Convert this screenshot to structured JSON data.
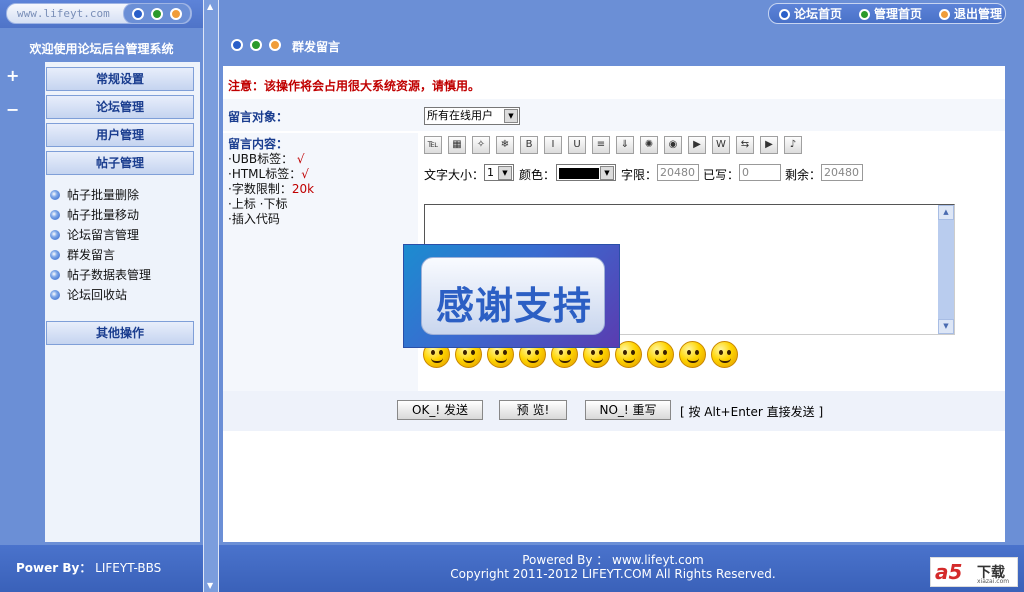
{
  "sidebar": {
    "site_url": "www.lifeyt.com",
    "welcome": "欢迎使用论坛后台管理系统",
    "plus": "+",
    "minus": "−",
    "menu": [
      {
        "label": "常规设置"
      },
      {
        "label": "论坛管理"
      },
      {
        "label": "用户管理"
      },
      {
        "label": "帖子管理"
      },
      {
        "label": "其他操作"
      }
    ],
    "sub_items": [
      {
        "label": "帖子批量删除"
      },
      {
        "label": "帖子批量移动"
      },
      {
        "label": "论坛留言管理"
      },
      {
        "label": "群发留言"
      },
      {
        "label": "帖子数据表管理"
      },
      {
        "label": "论坛回收站"
      }
    ],
    "footer_label": "Power By：",
    "footer_value": "LIFEYT-BBS"
  },
  "topnav": {
    "links": [
      {
        "label": "论坛首页",
        "dot_color": "#2a5fc9"
      },
      {
        "label": "管理首页",
        "dot_color": "#2b9a2b"
      },
      {
        "label": "退出管理",
        "dot_color": "#f09d3a"
      }
    ]
  },
  "page": {
    "title": "群发留言",
    "warning": "注意：该操作将会占用很大系统资源，请慎用。"
  },
  "form": {
    "target_label": "留言对象：",
    "target_value": "所有在线用户",
    "content_label": "留言内容：",
    "info": [
      {
        "label": "·UBB标签：",
        "value": "√"
      },
      {
        "label": "·HTML标签：",
        "value": "√"
      },
      {
        "label": "·字数限制：",
        "value": "20k"
      },
      {
        "label": "·上标 ·下标",
        "value": ""
      },
      {
        "label": "·插入代码",
        "value": ""
      }
    ],
    "toolbar_icons": [
      "format-icon",
      "bold-alt-icon",
      "image-icon",
      "link-icon",
      "bold-icon",
      "italic-icon",
      "underline-icon",
      "center-icon",
      "download-icon",
      "flash-icon",
      "media-icon",
      "play-icon",
      "web-icon",
      "quote-icon",
      "music-icon",
      "sound-icon"
    ],
    "toolbar_glyphs": [
      "℡",
      "▦",
      "✧",
      "❄",
      "B",
      "I",
      "U",
      "≡",
      "⇓",
      "✺",
      "◉",
      "▶",
      "W",
      "⇆",
      "▶",
      "♪"
    ],
    "font_size_label": "文字大小：",
    "font_size_value": "1",
    "color_label": "颜色：",
    "color_value": "#000000",
    "limit_label": "字限：",
    "limit_value": "20480",
    "written_label": "已写：",
    "written_value": "0",
    "remaining_label": "剩余：",
    "remaining_value": "20480",
    "up_arrow": "▲",
    "down_arrow": "▼"
  },
  "banner": {
    "text": "感谢支持"
  },
  "actions": {
    "ok": "OK_! 发送",
    "preview": "预  览!",
    "reset": "NO_! 重写",
    "hint": "[ 按 Alt+Enter 直接发送 ]"
  },
  "footer": {
    "powered": "Powered By ： www.lifeyt.com",
    "copyright": "Copyright 2011-2012 LIFEYT.COM All Rights Reserved."
  },
  "logo": {
    "a5": "a5",
    "dl": "下载",
    "sub": "xiazai.com"
  }
}
